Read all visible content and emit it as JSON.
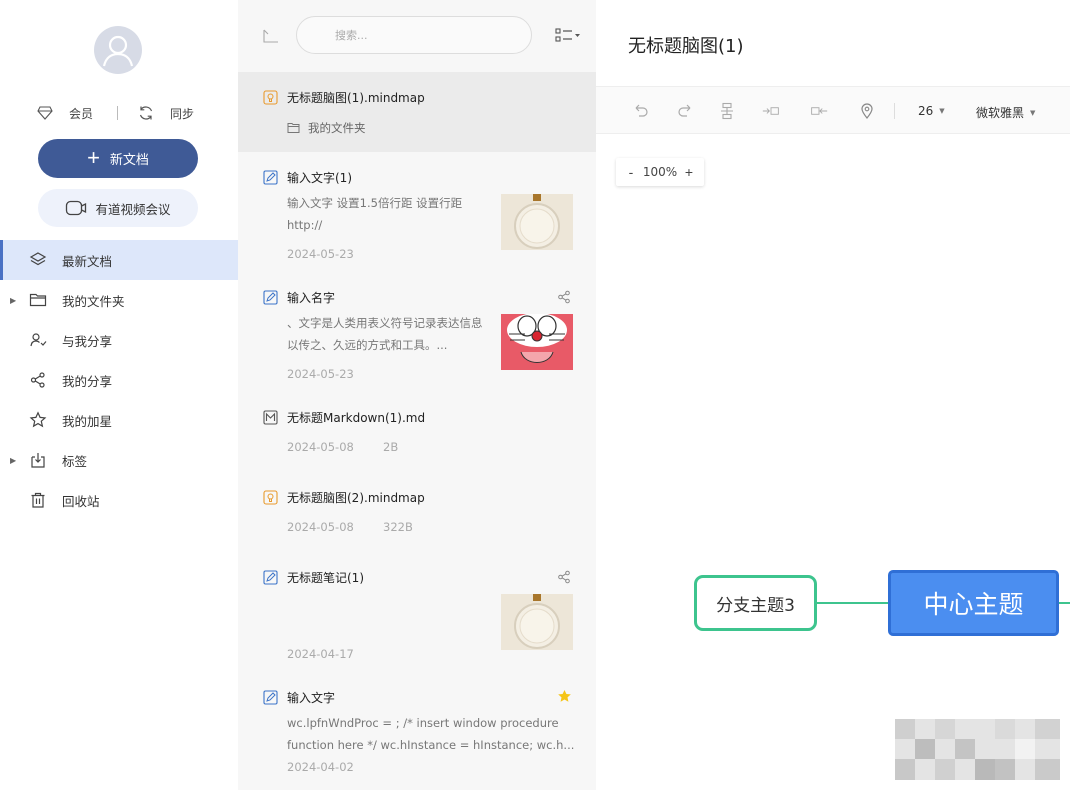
{
  "sidebar": {
    "vip_label": "会员",
    "sync_label": "同步",
    "new_doc_label": "新文档",
    "video_meeting_label": "有道视频会议",
    "nav": [
      {
        "label": "最新文档",
        "icon": "layers-icon",
        "active": true,
        "expandable": false
      },
      {
        "label": "我的文件夹",
        "icon": "folder-icon",
        "active": false,
        "expandable": true
      },
      {
        "label": "与我分享",
        "icon": "shared-with-me-icon",
        "active": false,
        "expandable": false
      },
      {
        "label": "我的分享",
        "icon": "share-icon",
        "active": false,
        "expandable": false
      },
      {
        "label": "我的加星",
        "icon": "star-outline-icon",
        "active": false,
        "expandable": false
      },
      {
        "label": "标签",
        "icon": "tag-icon",
        "active": false,
        "expandable": true
      },
      {
        "label": "回收站",
        "icon": "trash-icon",
        "active": false,
        "expandable": false
      }
    ]
  },
  "filelist": {
    "search_placeholder": "搜索...",
    "files": [
      {
        "name": "无标题脑图(1).mindmap",
        "type": "mindmap",
        "folder": "我的文件夹"
      },
      {
        "name": "输入文字(1)",
        "type": "note",
        "snippet": "输入文字 设置1.5倍行距 设置行距 http://",
        "date": "2024-05-23",
        "thumb": "pendant"
      },
      {
        "name": "输入名字",
        "type": "note",
        "snippet": "、文字是人类用表义符号记录表达信息以传之、久远的方式和工具。...",
        "date": "2024-05-23",
        "thumb": "doraemon",
        "shared": true
      },
      {
        "name": "无标题Markdown(1).md",
        "type": "markdown",
        "date": "2024-05-08",
        "size": "2B"
      },
      {
        "name": "无标题脑图(2).mindmap",
        "type": "mindmap",
        "date": "2024-05-08",
        "size": "322B"
      },
      {
        "name": "无标题笔记(1)",
        "type": "note",
        "date": "2024-04-17",
        "thumb": "pendant",
        "shared": true
      },
      {
        "name": "输入文字",
        "type": "note",
        "snippet": "wc.lpfnWndProc = ; /* insert window procedure function here */ wc.hInstance = hInstance; wc.h...",
        "date": "2024-04-02",
        "starred": true
      }
    ]
  },
  "editor": {
    "title": "无标题脑图(1)",
    "font_size": "26",
    "font_name": "微软雅黑",
    "zoom": "100%",
    "zoom_minus": "-",
    "zoom_plus": "+",
    "branch_topic": "分支主题3",
    "center_topic": "中心主题"
  },
  "colors": {
    "primary_button": "#3f5a96",
    "active_nav_bg": "#dde7fa",
    "center_topic_fill": "#4b8ef0",
    "branch_border": "#3dc48e",
    "star": "#f5c518"
  }
}
